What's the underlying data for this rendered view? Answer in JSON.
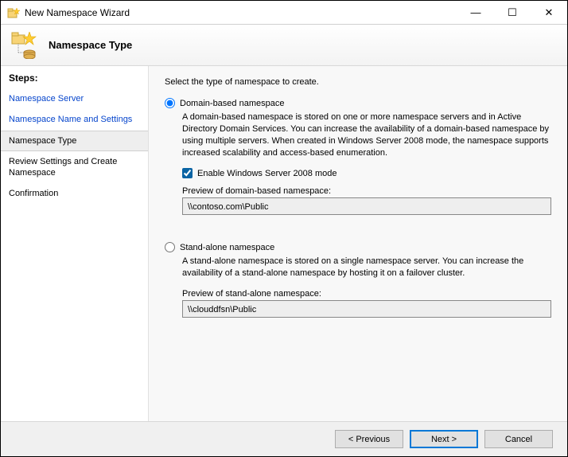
{
  "titlebar": {
    "title": "New Namespace Wizard"
  },
  "header": {
    "title": "Namespace Type"
  },
  "sidebar": {
    "heading": "Steps:",
    "items": [
      {
        "label": "Namespace Server",
        "kind": "link"
      },
      {
        "label": "Namespace Name and Settings",
        "kind": "link"
      },
      {
        "label": "Namespace Type",
        "kind": "current"
      },
      {
        "label": "Review Settings and Create Namespace",
        "kind": "plain"
      },
      {
        "label": "Confirmation",
        "kind": "plain"
      }
    ]
  },
  "content": {
    "intro": "Select the type of namespace to create.",
    "option1": {
      "radio_label": "Domain-based namespace",
      "selected": true,
      "desc": "A domain-based namespace is stored on one or more namespace servers and in Active Directory Domain Services. You can increase the availability of a domain-based namespace by using multiple servers. When created in Windows Server 2008 mode, the namespace supports increased scalability and access-based enumeration.",
      "checkbox_label": "Enable Windows Server 2008 mode",
      "checkbox_checked": true,
      "preview_label": "Preview of domain-based namespace:",
      "preview_value": "\\\\contoso.com\\Public"
    },
    "option2": {
      "radio_label": "Stand-alone namespace",
      "selected": false,
      "desc": "A stand-alone namespace is stored on a single namespace server. You can increase the availability of a stand-alone namespace by hosting it on a failover cluster.",
      "preview_label": "Preview of stand-alone namespace:",
      "preview_value": "\\\\clouddfsn\\Public"
    }
  },
  "footer": {
    "previous": "< Previous",
    "next": "Next >",
    "cancel": "Cancel"
  }
}
